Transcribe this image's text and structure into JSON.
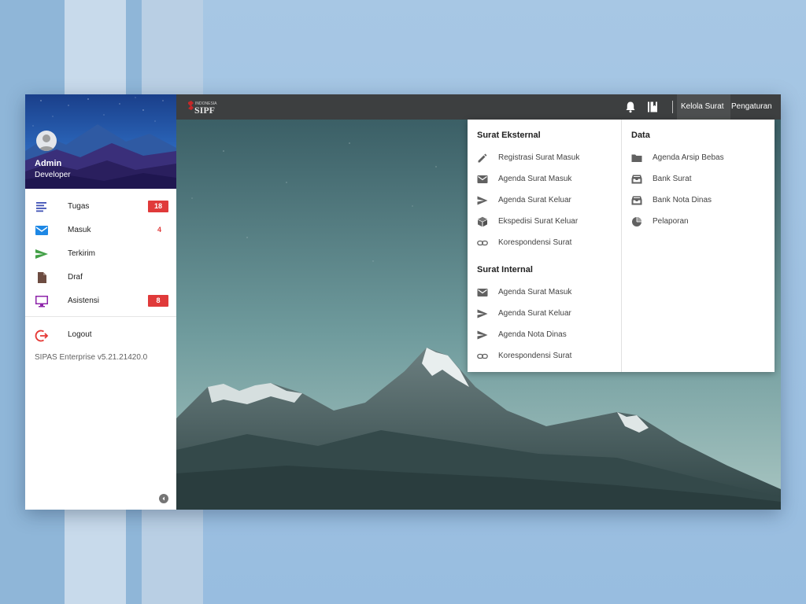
{
  "sidebar": {
    "user": {
      "name": "Admin",
      "role": "Developer"
    },
    "items": [
      {
        "icon": "list-icon",
        "label": "Tugas",
        "badge": "18",
        "badge_style": "box",
        "color": "#3f51b5"
      },
      {
        "icon": "mail-icon",
        "label": "Masuk",
        "badge": "4",
        "badge_style": "text",
        "color": "#1e88e5"
      },
      {
        "icon": "send-icon",
        "label": "Terkirim",
        "badge": "",
        "badge_style": "none",
        "color": "#43a047"
      },
      {
        "icon": "file-icon",
        "label": "Draf",
        "badge": "",
        "badge_style": "none",
        "color": "#6d4c41"
      },
      {
        "icon": "monitor-icon",
        "label": "Asistensi",
        "badge": "8",
        "badge_style": "box",
        "color": "#8e24aa"
      }
    ],
    "logout": {
      "icon": "logout-icon",
      "label": "Logout",
      "color": "#e53935"
    },
    "version": "SIPAS Enterprise v5.21.21420.0"
  },
  "topbar": {
    "logo": {
      "small_text": "INDONESIA",
      "big_text": "SIPF"
    },
    "icons": [
      "bell-icon",
      "book-icon"
    ],
    "links": {
      "kelola_surat": "Kelola Surat",
      "pengaturan": "Pengaturan"
    }
  },
  "dropdown": {
    "surat_eksternal": {
      "title": "Surat Eksternal",
      "items": [
        {
          "icon": "pencil-icon",
          "label": "Registrasi Surat Masuk"
        },
        {
          "icon": "mail-icon",
          "label": "Agenda Surat Masuk"
        },
        {
          "icon": "send-icon",
          "label": "Agenda Surat Keluar"
        },
        {
          "icon": "box-icon",
          "label": "Ekspedisi Surat Keluar"
        },
        {
          "icon": "link-icon",
          "label": "Korespondensi Surat"
        }
      ]
    },
    "surat_internal": {
      "title": "Surat Internal",
      "items": [
        {
          "icon": "mail-icon",
          "label": "Agenda Surat Masuk"
        },
        {
          "icon": "send-icon",
          "label": "Agenda Surat Keluar"
        },
        {
          "icon": "send-icon",
          "label": "Agenda Nota Dinas"
        },
        {
          "icon": "link-icon",
          "label": "Korespondensi Surat"
        }
      ]
    },
    "data": {
      "title": "Data",
      "items": [
        {
          "icon": "folder-icon",
          "label": "Agenda Arsip Bebas"
        },
        {
          "icon": "inbox-icon",
          "label": "Bank Surat"
        },
        {
          "icon": "inbox-icon",
          "label": "Bank Nota Dinas"
        },
        {
          "icon": "pie-chart-icon",
          "label": "Pelaporan"
        }
      ]
    }
  },
  "colors": {
    "badge": "#e03a3a",
    "topbar": "#3d3f40",
    "profile_top": "#1a3f8a",
    "profile_bottom": "#4a83c9"
  }
}
